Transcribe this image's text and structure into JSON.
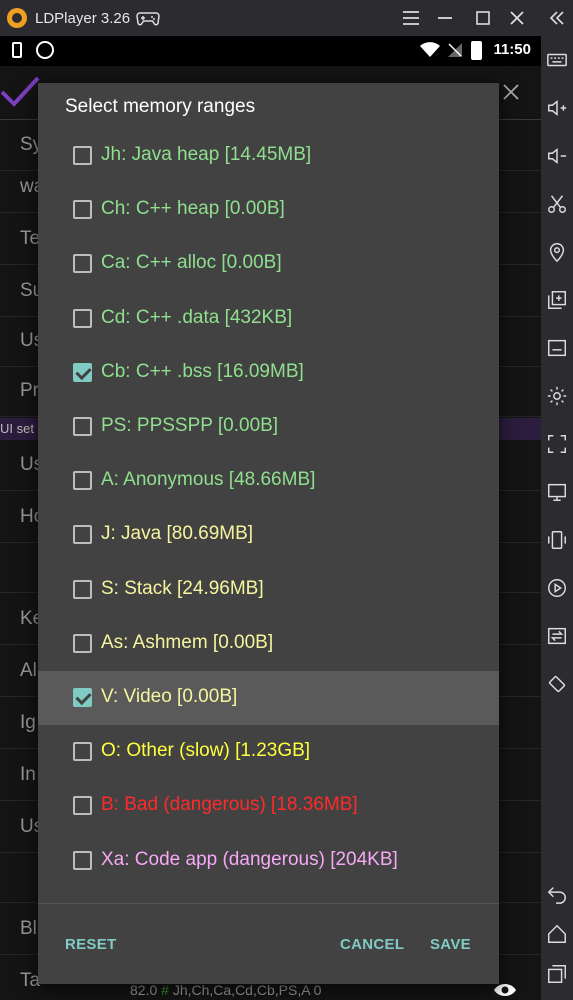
{
  "window": {
    "app_title": "LDPlayer 3.26",
    "time": "11:50"
  },
  "background": {
    "rows": [
      "Sy",
      "wa",
      "Te",
      "Su",
      "Us",
      "Pr",
      "Us",
      "Ho",
      "",
      "Ke",
      "Al",
      "Ig",
      "In",
      "Us",
      "",
      "Bl",
      "Ta"
    ],
    "section_label": "UI set",
    "bottom_text_prefix": "82.0 ",
    "bottom_text_hash": "#",
    "bottom_text_suffix": " Jh,Ch,Ca,Cd,Cb,PS,A 0"
  },
  "dialog": {
    "title": "Select memory ranges",
    "options": [
      {
        "label": "Jh: Java heap [14.45MB]",
        "checked": false,
        "color": "#8fdf8f"
      },
      {
        "label": "Ch: C++ heap [0.00B]",
        "checked": false,
        "color": "#8fdf8f"
      },
      {
        "label": "Ca: C++ alloc [0.00B]",
        "checked": false,
        "color": "#8fdf8f"
      },
      {
        "label": "Cd: C++ .data [432KB]",
        "checked": false,
        "color": "#8fdf8f"
      },
      {
        "label": "Cb: C++ .bss [16.09MB]",
        "checked": true,
        "color": "#8fdf8f"
      },
      {
        "label": "PS: PPSSPP [0.00B]",
        "checked": false,
        "color": "#8fdf8f"
      },
      {
        "label": "A: Anonymous [48.66MB]",
        "checked": false,
        "color": "#8fdf8f"
      },
      {
        "label": "J: Java [80.69MB]",
        "checked": false,
        "color": "#f5f5a0"
      },
      {
        "label": "S: Stack [24.96MB]",
        "checked": false,
        "color": "#f5f5a0"
      },
      {
        "label": "As: Ashmem [0.00B]",
        "checked": false,
        "color": "#f5f5a0"
      },
      {
        "label": "V: Video [0.00B]",
        "checked": true,
        "color": "#f5f5a0",
        "highlighted": true
      },
      {
        "label": "O: Other (slow) [1.23GB]",
        "checked": false,
        "color": "#ffff3c"
      },
      {
        "label": "B: Bad (dangerous) [18.36MB]",
        "checked": false,
        "color": "#ff2a2a"
      },
      {
        "label": "Xa: Code app (dangerous) [204KB]",
        "checked": false,
        "color": "#f7a8f7"
      }
    ],
    "reset_label": "RESET",
    "cancel_label": "CANCEL",
    "save_label": "SAVE"
  },
  "colors": {
    "accent": "#80cbc4",
    "dialog_bg": "#424242"
  }
}
